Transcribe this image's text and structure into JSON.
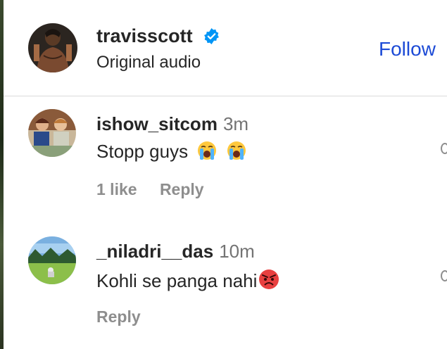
{
  "post_header": {
    "username": "travisscott",
    "subtitle": "Original audio",
    "follow_label": "Follow",
    "verified_icon": "verified-badge-icon",
    "accent_color": "#1d4bd6"
  },
  "comments": [
    {
      "username": "ishow_sitcom",
      "time": "3m",
      "text": "Stopp guys",
      "emojis": [
        "loudly-crying-face-icon",
        "loudly-crying-face-icon"
      ],
      "likes": "1 like",
      "reply_label": "Reply"
    },
    {
      "username": "_niladri__das",
      "time": "10m",
      "text": "Kohli se panga nahi",
      "emojis": [
        "angry-face-icon"
      ],
      "reply_label": "Reply"
    }
  ]
}
